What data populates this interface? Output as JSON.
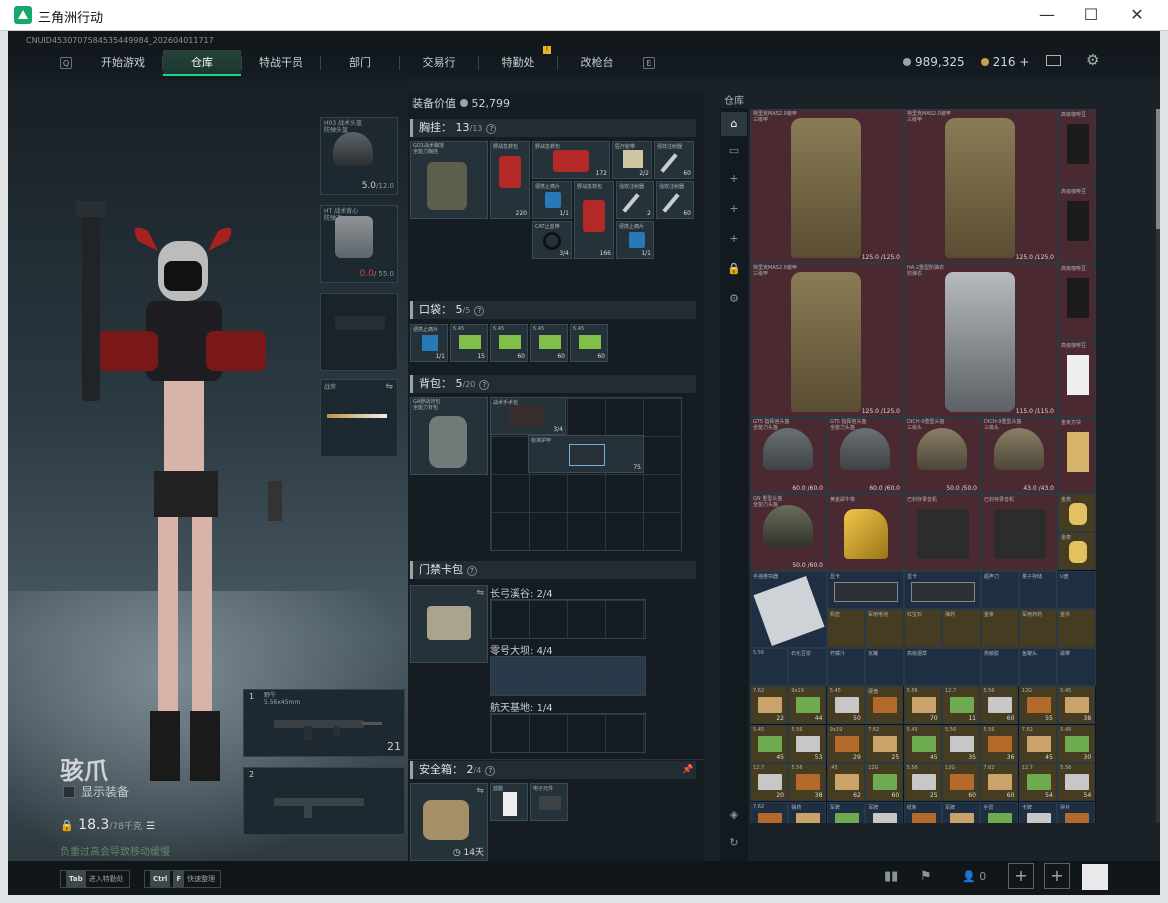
{
  "window": {
    "title": "三角洲行动",
    "controls": {
      "minimize": "—",
      "maximize": "☐",
      "close": "✕"
    }
  },
  "uid": "CNUID4530707584535449984_202604011717",
  "nav": {
    "key_left": "Q",
    "key_right": "E",
    "badge": "!",
    "tabs": [
      "开始游戏",
      "仓库",
      "特战干员",
      "部门",
      "交易行",
      "特勤处",
      "改枪台"
    ],
    "active": "仓库"
  },
  "currency": {
    "silver": "989,325",
    "gold": "216 +"
  },
  "character": {
    "name": "骇爪",
    "show_equip": "显示装备",
    "weight": "18.3",
    "weight_max": "/78千克",
    "tip": "负重过高会导致移动缓慢"
  },
  "gear_slots": {
    "helmet": {
      "label": "H03 战术头盔\n防弹头盔",
      "value": "5.0",
      "max": "/12.0"
    },
    "armor": {
      "label": "HT 战术背心\n防弹衣",
      "value": "0.0",
      "max": "/ 55.0"
    },
    "melee": {
      "label": "战斧"
    },
    "primary": {
      "num": "1",
      "label": "野牛\n5.56x45mm",
      "ammo": "21"
    },
    "secondary": {
      "num": "2"
    }
  },
  "equip_value": {
    "label": "装备价值",
    "value": "52,799"
  },
  "sections": {
    "chest": {
      "title": "胸挂",
      "count": "13",
      "max": "/13"
    },
    "pocket": {
      "title": "口袋",
      "count": "5",
      "max": "/5"
    },
    "backpack": {
      "title": "背包",
      "count": "5",
      "max": "/20"
    },
    "keycard": {
      "title": "门禁卡包"
    },
    "safe": {
      "title": "安全箱",
      "count": "2",
      "max": "/4",
      "timer": "14天"
    }
  },
  "chest_items": [
    {
      "label": "GO1战术胸挂\n全能力胸挂",
      "num": ""
    },
    {
      "label": "野战急救包",
      "num": "220"
    },
    {
      "label": "野战急救包",
      "num": "172"
    },
    {
      "label": "医疗胶带",
      "num": "2/2"
    },
    {
      "label": "强效注射器",
      "num": "60"
    },
    {
      "label": "便携止痛片",
      "num": "1/1"
    },
    {
      "label": "野战急救包",
      "num": ""
    },
    {
      "label": "强效注射器",
      "num": "2"
    },
    {
      "label": "强效注射器",
      "num": "60"
    },
    {
      "label": "CAT止血带",
      "num": "3/4"
    },
    {
      "label": "野战急救包",
      "num": "166"
    },
    {
      "label": "便携止痛片",
      "num": "1/1"
    }
  ],
  "pocket_items": [
    {
      "label": "便携止痛片",
      "num": "1/1"
    },
    {
      "label": "5.45",
      "num": "15"
    },
    {
      "label": "5.45",
      "num": "60"
    },
    {
      "label": "5.45",
      "num": "60"
    },
    {
      "label": "5.45",
      "num": "60"
    }
  ],
  "backpack_items": [
    {
      "label": "GA野战背包\n全能力背包",
      "num": ""
    },
    {
      "label": "战术手术包",
      "num": "3/4"
    },
    {
      "label": "标准护甲",
      "num": "75"
    }
  ],
  "keycards": [
    {
      "name": "长弓溪谷",
      "count": "2/4"
    },
    {
      "name": "零号大坝",
      "count": "4/4"
    },
    {
      "name": "航天基地",
      "count": "1/4"
    }
  ],
  "safe_items": [
    {
      "label": "盐酸",
      "num": ""
    },
    {
      "label": "电子元件",
      "num": ""
    }
  ],
  "warehouse": {
    "title": "仓库",
    "armors": [
      {
        "label": "特里克MAS2.0装甲\n三级甲",
        "dur": "125.0 /125.0"
      },
      {
        "label": "特里克MAS2.0装甲\n三级甲",
        "dur": "125.0 /125.0"
      },
      {
        "label": "特里克MAS2.0装甲\n三级甲",
        "dur": "125.0 /125.0"
      },
      {
        "label": "HA-2重型防弹衣\n防弹衣",
        "dur": "115.0 /115.0"
      }
    ],
    "helmets": [
      {
        "label": "GT5 指挥官头盔\n全能力头盔",
        "dur": "60.0 /60.0"
      },
      {
        "label": "GT5 指挥官头盔\n全能力头盔",
        "dur": "60.0 /60.0"
      },
      {
        "label": "DICH-9重型头盔\n三级头",
        "dur": "50.0 /50.0"
      },
      {
        "label": "DICH-9重型头盔\n三级头",
        "dur": "43.0 /43.0"
      },
      {
        "label": "GN 重型头盔\n全能力头盔",
        "dur": "50.0 /60.0"
      }
    ],
    "side": [
      {
        "label": "高级咖啡豆"
      },
      {
        "label": "高级咖啡豆"
      },
      {
        "label": "高级咖啡豆"
      },
      {
        "label": "高级咖啡豆"
      },
      {
        "label": "金条方块"
      },
      {
        "label": "咖啡豆"
      },
      {
        "label": "金表"
      },
      {
        "label": "金表"
      }
    ],
    "row_items": [
      {
        "label": "黄金犀牛像"
      },
      {
        "label": "已封存录音机"
      },
      {
        "label": "已封存录音机"
      },
      {
        "label": "手摇卷帘器"
      },
      {
        "label": "显卡"
      },
      {
        "label": "显卡"
      },
      {
        "label": "超声刀"
      },
      {
        "label": "量子存储"
      },
      {
        "label": "U盘"
      },
      {
        "label": "机密"
      },
      {
        "label": "军用电池"
      },
      {
        "label": "红宝石"
      },
      {
        "label": "弹药"
      },
      {
        "label": "金条"
      },
      {
        "label": "军用炸药"
      },
      {
        "label": "金币"
      },
      {
        "label": "5.56"
      },
      {
        "label": "石化豆浆"
      },
      {
        "label": "柠檬汁"
      },
      {
        "label": "瓦罐"
      },
      {
        "label": "高级烟草"
      },
      {
        "label": "热敏胶"
      },
      {
        "label": "鱼罐头"
      },
      {
        "label": "磁带"
      }
    ],
    "ammo_rows": [
      [
        {
          "lbl": "7.62",
          "n": "22"
        },
        {
          "lbl": "9x19",
          "n": "44"
        },
        {
          "lbl": "5.45",
          "n": "50"
        },
        {
          "lbl": "硬盘",
          "n": ""
        },
        {
          "lbl": "5.56",
          "n": "70"
        },
        {
          "lbl": "12.7",
          "n": "11"
        },
        {
          "lbl": "5.56",
          "n": "60"
        },
        {
          "lbl": "12G",
          "n": "55"
        },
        {
          "lbl": "5.45",
          "n": "38"
        }
      ],
      [
        {
          "lbl": "5.45",
          "n": "45"
        },
        {
          "lbl": "5.56",
          "n": "53"
        },
        {
          "lbl": "9x19",
          "n": "29"
        },
        {
          "lbl": "7.62",
          "n": "25"
        },
        {
          "lbl": "5.45",
          "n": "45"
        },
        {
          "lbl": "5.56",
          "n": "35"
        },
        {
          "lbl": "5.56",
          "n": "36"
        },
        {
          "lbl": "7.62",
          "n": "45"
        },
        {
          "lbl": "5.45",
          "n": "30"
        }
      ],
      [
        {
          "lbl": "12.7",
          "n": "20"
        },
        {
          "lbl": "5.56",
          "n": "38"
        },
        {
          "lbl": ".45",
          "n": "62"
        },
        {
          "lbl": "12G",
          "n": "60"
        },
        {
          "lbl": "5.56",
          "n": "25"
        },
        {
          "lbl": "12G",
          "n": "60"
        },
        {
          "lbl": "7.62",
          "n": "60"
        },
        {
          "lbl": "12.7",
          "n": "54"
        },
        {
          "lbl": "5.56",
          "n": "54"
        }
      ],
      [
        {
          "lbl": "7.62",
          "n": "6"
        },
        {
          "lbl": "弹药",
          "n": ""
        },
        {
          "lbl": "军牌",
          "n": ""
        },
        {
          "lbl": "军牌",
          "n": ""
        },
        {
          "lbl": "纸条",
          "n": ""
        },
        {
          "lbl": "军牌",
          "n": ""
        },
        {
          "lbl": "手雷",
          "n": ""
        },
        {
          "lbl": "卡牌",
          "n": ""
        },
        {
          "lbl": "碎片",
          "n": ""
        }
      ]
    ]
  },
  "bottom": {
    "tab_key": "Tab",
    "tab_label": "进入特勤处",
    "ctrl_key": "Ctrl",
    "f_key": "F",
    "f_label": "快速整理",
    "players": "0"
  }
}
